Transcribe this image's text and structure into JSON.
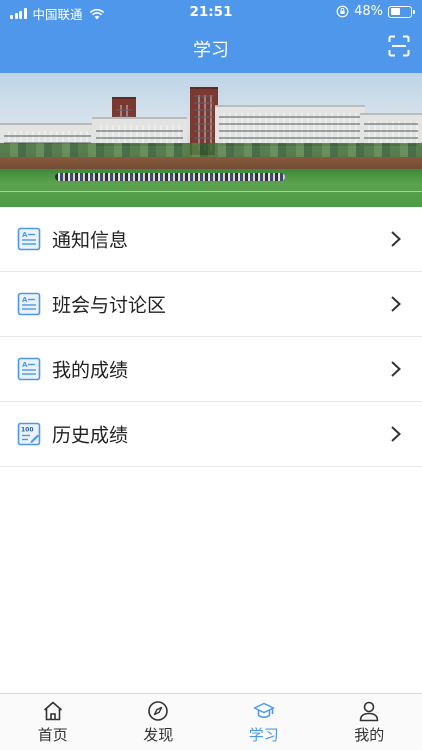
{
  "status_bar": {
    "carrier": "中国联通",
    "time": "21:51",
    "battery_percent": "48%",
    "battery_level": 0.48
  },
  "header": {
    "title": "学习",
    "scan_icon": "scan-icon"
  },
  "banner": {
    "icon": "campus-banner-image"
  },
  "menu": {
    "items": [
      {
        "label": "通知信息",
        "icon": "notice-document-icon"
      },
      {
        "label": "班会与讨论区",
        "icon": "discussion-document-icon"
      },
      {
        "label": "我的成绩",
        "icon": "grades-document-icon"
      },
      {
        "label": "历史成绩",
        "icon": "score-history-icon"
      }
    ]
  },
  "tabbar": {
    "active": 2,
    "tabs": [
      {
        "label": "首页",
        "icon": "home-icon"
      },
      {
        "label": "发现",
        "icon": "compass-icon"
      },
      {
        "label": "学习",
        "icon": "graduation-cap-icon"
      },
      {
        "label": "我的",
        "icon": "person-icon"
      }
    ]
  },
  "colors": {
    "primary": "#4e97ea",
    "text": "#222222",
    "divider": "#e9e9e9"
  }
}
